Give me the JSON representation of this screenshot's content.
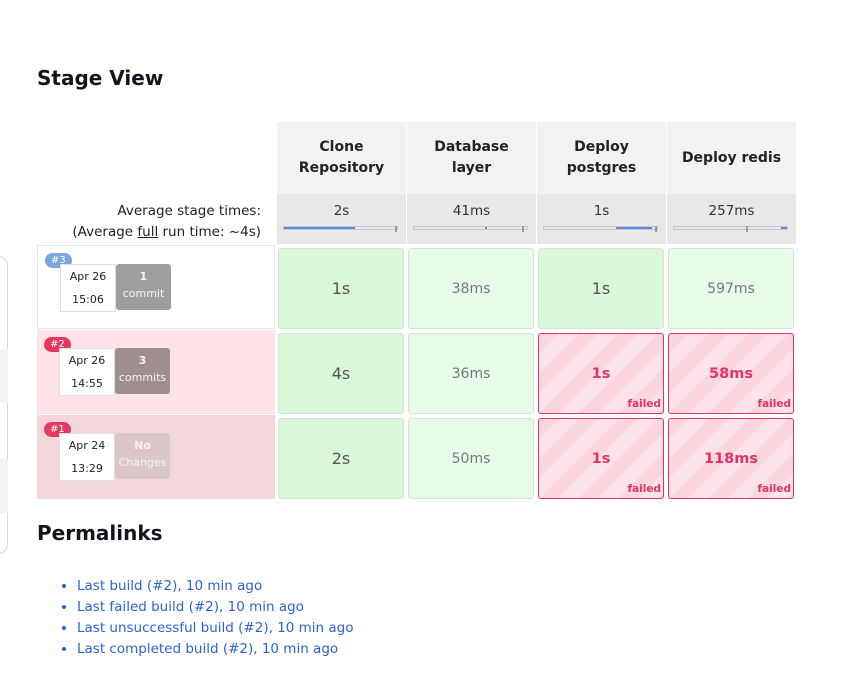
{
  "stage_view": {
    "title": "Stage View",
    "avg_label_line1": "Average stage times:",
    "avg_label_prefix": "(Average ",
    "avg_label_full": "full",
    "avg_label_suffix": " run time: ~4s)",
    "stages": [
      {
        "name_line1": "Clone",
        "name_line2": "Repository",
        "avg": "2s",
        "bar_fill": 0.63
      },
      {
        "name_line1": "Database",
        "name_line2": "layer",
        "avg": "41ms",
        "bar_fill": 0.02
      },
      {
        "name_line1": "Deploy",
        "name_line2": "postgres",
        "avg": "1s",
        "bar_fill": 0.32
      },
      {
        "name_line1": "Deploy redis",
        "name_line2": "",
        "avg": "257ms",
        "bar_fill": 0.05
      }
    ],
    "builds": [
      {
        "badge": "#3",
        "badge_color": "#7aa6dd",
        "row_bg": "#ffffff",
        "date": "Apr 26",
        "time": "15:06",
        "commit_count": "1",
        "commit_label": "commit",
        "commit_bg": "#9e9e9e",
        "cells": [
          {
            "value": "1s",
            "status": "ok-dark",
            "fail_label": ""
          },
          {
            "value": "38ms",
            "status": "ok-light",
            "fail_label": ""
          },
          {
            "value": "1s",
            "status": "ok-dark",
            "fail_label": ""
          },
          {
            "value": "597ms",
            "status": "ok-light",
            "fail_label": ""
          }
        ]
      },
      {
        "badge": "#2",
        "badge_color": "#e43860",
        "row_bg": "#fde3e7",
        "date": "Apr 26",
        "time": "14:55",
        "commit_count": "3",
        "commit_label": "commits",
        "commit_bg": "#9e8e90",
        "cells": [
          {
            "value": "4s",
            "status": "ok-dark",
            "fail_label": ""
          },
          {
            "value": "36ms",
            "status": "ok-light",
            "fail_label": ""
          },
          {
            "value": "1s",
            "status": "failed",
            "fail_label": "failed"
          },
          {
            "value": "58ms",
            "status": "failed",
            "fail_label": "failed"
          }
        ]
      },
      {
        "badge": "#1",
        "badge_color": "#e43860",
        "row_bg": "#f2d6da",
        "date": "Apr 24",
        "time": "13:29",
        "commit_count": "No",
        "commit_label": "Changes",
        "commit_bg": "#dcc6c9",
        "cells": [
          {
            "value": "2s",
            "status": "ok-dark",
            "fail_label": ""
          },
          {
            "value": "50ms",
            "status": "ok-light",
            "fail_label": ""
          },
          {
            "value": "1s",
            "status": "failed",
            "fail_label": "failed"
          },
          {
            "value": "118ms",
            "status": "failed",
            "fail_label": "failed"
          }
        ]
      }
    ]
  },
  "permalinks": {
    "title": "Permalinks",
    "links": [
      "Last build (#2), 10 min ago",
      "Last failed build (#2), 10 min ago",
      "Last unsuccessful build (#2), 10 min ago",
      "Last completed build (#2), 10 min ago"
    ]
  }
}
